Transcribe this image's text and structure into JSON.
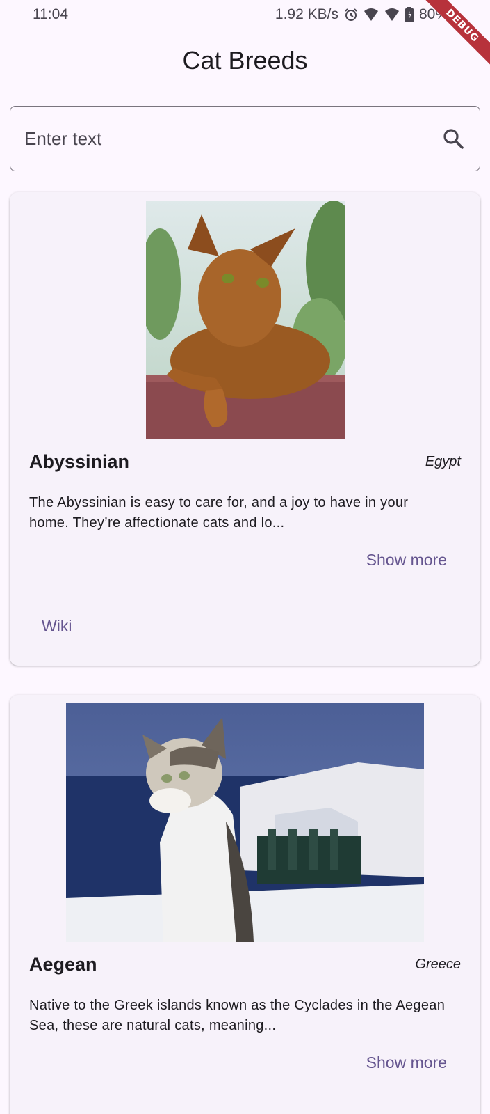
{
  "status_bar": {
    "time": "11:04",
    "network_speed": "1.92 KB/s",
    "battery": "80%",
    "icons": [
      "alarm-icon",
      "wifi-icon",
      "signal-icon",
      "battery-icon"
    ]
  },
  "debug_banner": "DEBUG",
  "app_bar": {
    "title": "Cat Breeds"
  },
  "search": {
    "placeholder": "Enter text",
    "value": "",
    "icon": "search-icon"
  },
  "breeds": [
    {
      "name": "Abyssinian",
      "origin": "Egypt",
      "description": "The Abyssinian is easy to care for, and a joy to have in your home. They’re affectionate cats and lo...",
      "show_more_label": "Show more",
      "wiki_label": "Wiki"
    },
    {
      "name": "Aegean",
      "origin": "Greece",
      "description": "Native to the Greek islands known as the Cyclades in the Aegean Sea, these are natural cats, meaning...",
      "show_more_label": "Show more"
    }
  ],
  "colors": {
    "background": "#fdf7ff",
    "card": "#f7f2fa",
    "accent": "#65558f",
    "text": "#1d1b20",
    "outline": "#79747e",
    "debug_ribbon": "#b7323b"
  }
}
